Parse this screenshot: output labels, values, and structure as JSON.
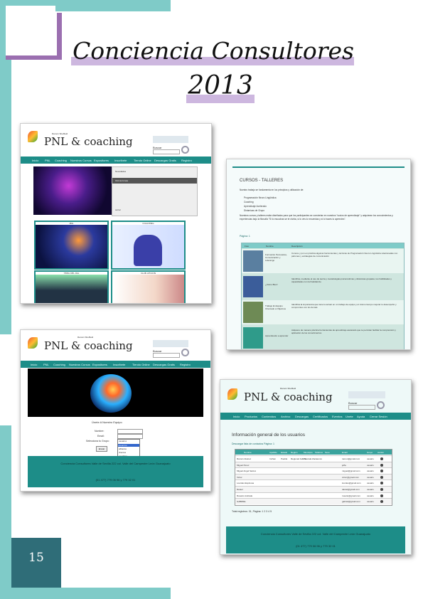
{
  "title_line1": "Conciencia Consultores",
  "title_line2": "2013",
  "page_number": "15",
  "site": {
    "logo_name": "PNL & coaching",
    "logo_tag": "Ramón Sheffield",
    "search_label": "Buscar",
    "nav": [
      "Inicio",
      "PNL",
      "Coaching",
      "Nuestros Cursos",
      "Expositores",
      "Inscribete",
      "Tiendo Online",
      "Descargas Gratis",
      "Registro"
    ],
    "menu_items": [
      "Novedades",
      "Ubicaciones",
      "cerrar"
    ],
    "tiles": [
      "PNL",
      "COACHING",
      "TEMA DEL DIA",
      "CLUB AFICIÓN"
    ]
  },
  "cursos": {
    "heading": "CURSOS - TALLERES",
    "intro": "Nuestro trabajo se fundamenta en los principios y utilización de:",
    "bullets": [
      "Programación Neuro Lingüística",
      "Coaching",
      "Aprendizaje Acelerado",
      "Dinámicas de Grupo"
    ],
    "paragraph": "Nuestros cursos y talleres están diseñados para que los participantes se conviertan en nuestros \"socios de aprendizaje\" y adquieran los conocimientos y experiencias bajo la filosofía \"Si lo escuchas se te olvida, si lo ves lo recuerdas y si lo haces lo aprendes\".",
    "pages_label": "Página: 1",
    "columns": [
      "Foto",
      "Nombre",
      "Descripción"
    ],
    "rows": [
      {
        "name": "Formación Persuasiva, Comunicación y Liderazgo",
        "desc": "Conoce y pon en práctica algunas herramientas y técnicas de Programación Neuro Lingüística relacionadas con patrones y estrategias de comunicación"
      },
      {
        "name": "¿Cómo Bien!",
        "desc": "Identifica, mediante el uso de teoría y metodologías psicométricas y dinámicas grupales, tus habilidades y capacidades con la finalidad de"
      },
      {
        "name": "Trabajo En Equipo Orientado a Objetivos",
        "desc": "Identifica la importancia que tiene la actuar en un trabajo de equipo y el mismo tiempo mejorar tu desempeño y compromiso con los demás"
      },
      {
        "name": "Aprendiendo a aprender",
        "desc": "Adquiere de manera práctica herramientas de aprendizaje acelerado que te permitan facilitar la comprensión y aplicación de los conocimientos"
      }
    ]
  },
  "registro": {
    "heading": "Únete A Nuestro Equipo",
    "fields": [
      "Nombre:",
      "Email:",
      "Selecciona tu Grupo:"
    ],
    "select_value": "usuarios",
    "options": [
      "usuarios",
      "afiliados",
      "clientes",
      "coaching"
    ],
    "button": "Enviar",
    "footer_line1": "Conciencia Consultores Valle de Sevilla 222 col. Valle del Campestre León Guanajuato",
    "footer_line2": "(01 477) 779 06 96 y 779 32 01"
  },
  "usuarios": {
    "nav": [
      "Inicio",
      "Productos",
      "Contenidos",
      "Archivo",
      "Descargas",
      "Certificados",
      "Eventos",
      "Unete",
      "Ayuda",
      "Cerrar Sesión"
    ],
    "heading": "Información general de los usuarios",
    "subheading": "Descargar lista de contactos Página: 1",
    "columns": [
      "Nombre",
      "Apellido",
      "Estado",
      "Región",
      "Municipio",
      "Teléfono",
      "Sexo",
      "Email",
      "Grupo",
      "Acción"
    ],
    "rows": [
      [
        "Ramón Alvarez",
        "Inchan",
        "Puebla",
        "Regional Jalisco",
        "Tlaxcala Zacatenco",
        "",
        "",
        "ramon@gmail.com",
        "usuario"
      ],
      [
        "Miguel Perez",
        "",
        "",
        "",
        "",
        "",
        "",
        "jeffa",
        "usuario"
      ],
      [
        "Miguel Angel Santos",
        "",
        "",
        "",
        "",
        "",
        "",
        "miguel@gmail.com",
        "usuario"
      ],
      [
        "Victor",
        "",
        "",
        "",
        "",
        "",
        "",
        "victor@gmail.com",
        "usuario"
      ],
      [
        "Lourdes Espinosa",
        "",
        "",
        "",
        "",
        "",
        "",
        "lourdes@gmail.com",
        "usuario"
      ],
      [
        "Daniel",
        "",
        "",
        "",
        "",
        "",
        "",
        "daniel@gmail.com",
        "usuario"
      ],
      [
        "Rosario Andrade",
        "",
        "",
        "",
        "",
        "",
        "",
        "rosario@gmail.com",
        "usuario"
      ],
      [
        "GABRIEL",
        "",
        "",
        "",
        "",
        "",
        "",
        "gabriel@gmail.com",
        "usuario"
      ]
    ],
    "total": "Total registros: 31, Página: 1 2 3 4 5"
  }
}
